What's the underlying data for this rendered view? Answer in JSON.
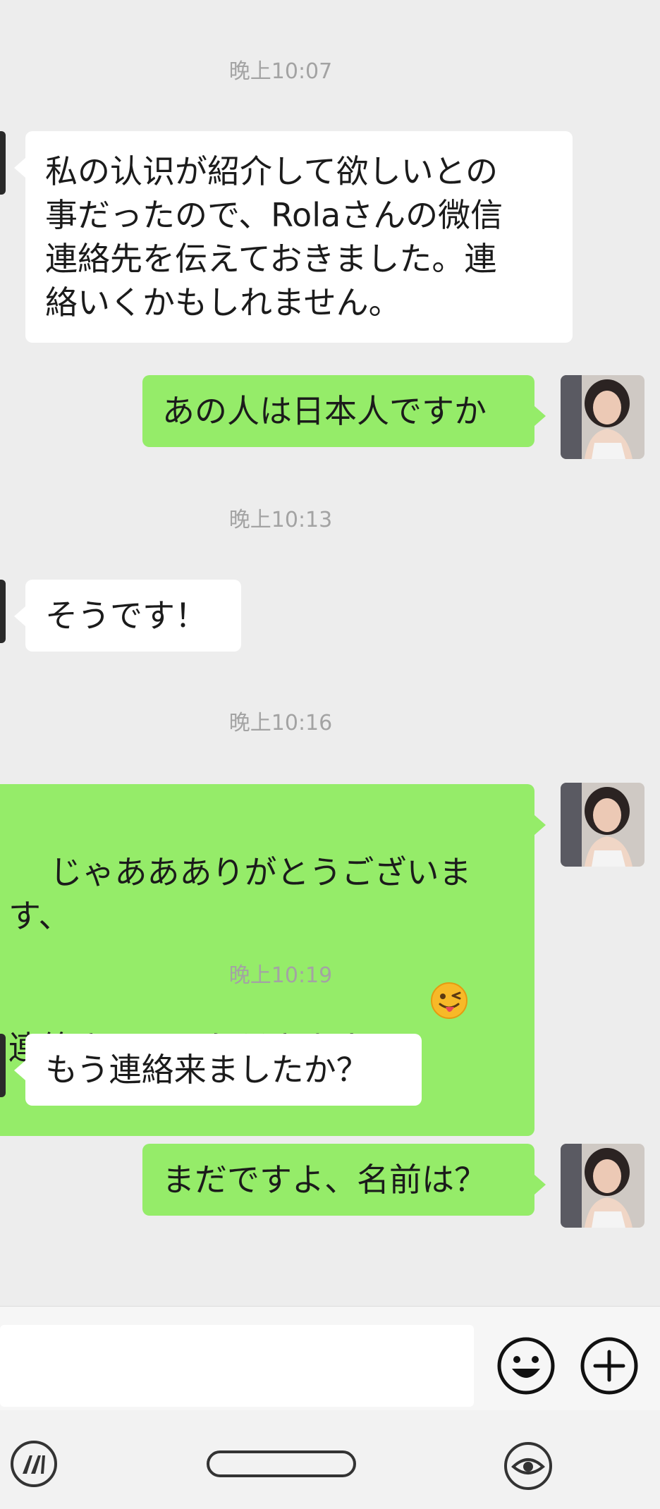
{
  "messages": [
    {
      "type": "timestamp",
      "text": "晚上10:07"
    },
    {
      "type": "incoming",
      "text": "私の认识が紹介して欲しいとの\n事だったので、Rolaさんの微信\n連絡先を伝えておきました。連\n絡いくかもしれません。"
    },
    {
      "type": "outgoing",
      "text": "あの人は日本人ですか"
    },
    {
      "type": "timestamp",
      "text": "晚上10:13"
    },
    {
      "type": "incoming",
      "text": "そうです！"
    },
    {
      "type": "timestamp",
      "text": "晚上10:16"
    },
    {
      "type": "outgoing",
      "text": "じゃああありがとうございます、\n連絡させていただきます",
      "emoji": "winking-tongue-emoji"
    },
    {
      "type": "timestamp",
      "text": "晚上10:19"
    },
    {
      "type": "incoming",
      "text": "もう連絡来ましたか？"
    },
    {
      "type": "outgoing",
      "text": "まだですよ、名前は？"
    }
  ],
  "input": {
    "value": "",
    "placeholder": ""
  },
  "icons": {
    "emoji_button": "smiley-face-icon",
    "more_button": "plus-circle-icon",
    "nav_left": "app-logo-icon",
    "nav_home": "home-pill-icon",
    "nav_right": "eye-icon"
  },
  "colors": {
    "background": "#ededed",
    "outgoing_bubble": "#95ec69",
    "incoming_bubble": "#ffffff",
    "timestamp": "#a3a3a3"
  }
}
